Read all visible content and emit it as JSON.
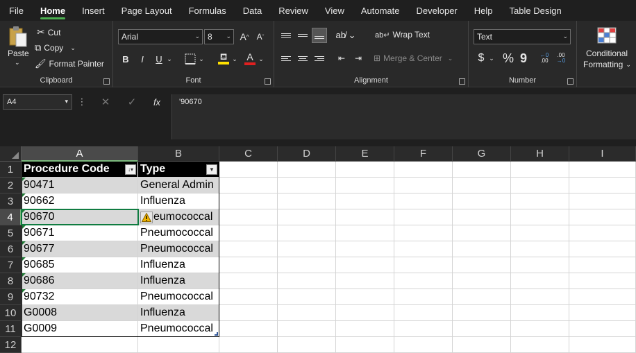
{
  "menu": {
    "tabs": [
      "File",
      "Home",
      "Insert",
      "Page Layout",
      "Formulas",
      "Data",
      "Review",
      "View",
      "Automate",
      "Developer",
      "Help",
      "Table Design"
    ],
    "active_tab": "Home"
  },
  "ribbon": {
    "clipboard": {
      "paste": "Paste",
      "cut": "Cut",
      "copy": "Copy",
      "format_painter": "Format Painter",
      "label": "Clipboard"
    },
    "font": {
      "font_name": "Arial",
      "font_size": "8",
      "bold": "B",
      "italic": "I",
      "underline": "U",
      "label": "Font"
    },
    "alignment": {
      "wrap_text": "Wrap Text",
      "merge_center": "Merge & Center",
      "label": "Alignment"
    },
    "number": {
      "format": "Text",
      "currency": "$",
      "percent": "%",
      "comma": "9",
      "label": "Number"
    },
    "styles": {
      "conditional_formatting_line1": "Conditional",
      "conditional_formatting_line2": "Formatting"
    }
  },
  "formula_bar": {
    "name_box": "A4",
    "fx": "fx",
    "formula": "'90670"
  },
  "grid": {
    "columns": [
      "A",
      "B",
      "C",
      "D",
      "E",
      "F",
      "G",
      "H",
      "I"
    ],
    "rows": [
      "1",
      "2",
      "3",
      "4",
      "5",
      "6",
      "7",
      "8",
      "9",
      "10",
      "11",
      "12"
    ],
    "selected_cell": "A4",
    "table": {
      "headers": [
        "Procedure Code",
        "Type"
      ],
      "rows": [
        [
          "90471",
          "General Admin"
        ],
        [
          "90662",
          "Influenza"
        ],
        [
          "90670",
          "eumococcal"
        ],
        [
          "90671",
          "Pneumococcal"
        ],
        [
          "90677",
          "Pneumococcal"
        ],
        [
          "90685",
          "Influenza"
        ],
        [
          "90686",
          "Influenza"
        ],
        [
          "90732",
          "Pneumococcal"
        ],
        [
          "G0008",
          "Influenza"
        ],
        [
          "G0009",
          "Pneumococcal"
        ]
      ]
    }
  },
  "colors": {
    "accent_green": "#107c41",
    "header_fill": "#000000",
    "band_fill": "#d9d9d9"
  }
}
